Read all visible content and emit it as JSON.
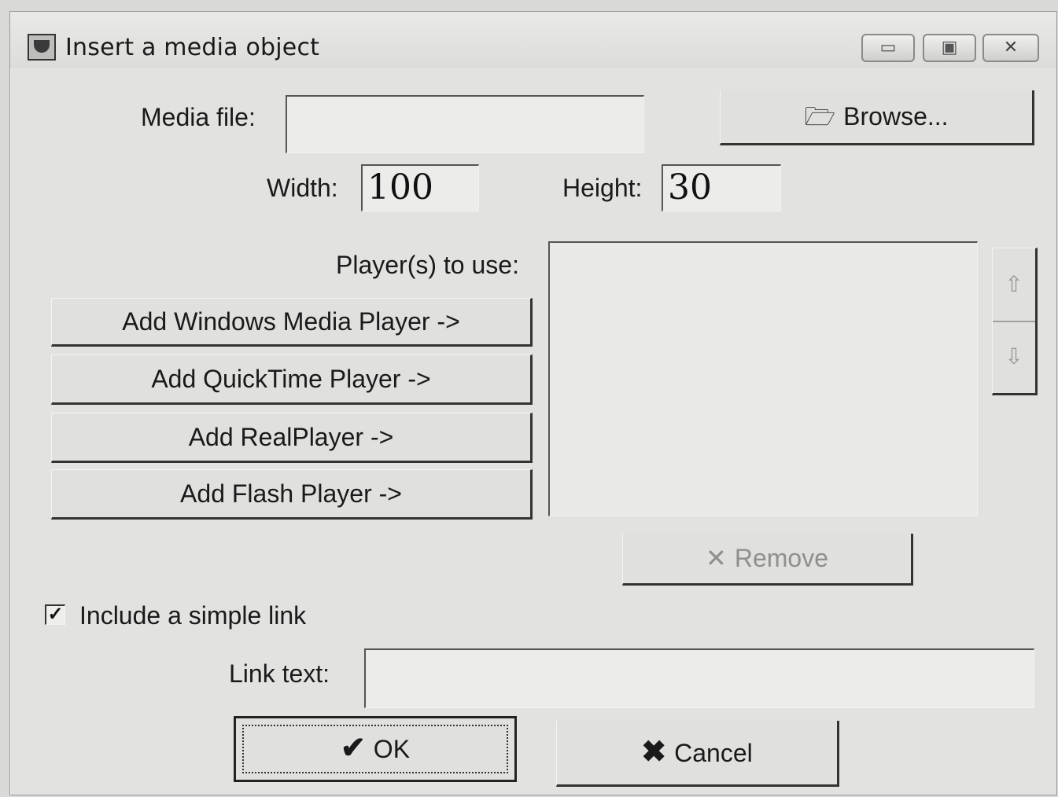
{
  "window": {
    "title": "Insert a media object",
    "controls": {
      "minimize": "▭",
      "maximize": "▣",
      "close": "✕"
    }
  },
  "media_file": {
    "label": "Media file:",
    "value": "",
    "browse_icon": "folder-open-icon",
    "browse_glyph": "🗁",
    "browse_label": "Browse..."
  },
  "size": {
    "width_label": "Width:",
    "width_value": "100",
    "height_label": "Height:",
    "height_value": "30"
  },
  "players": {
    "label": "Player(s) to use:",
    "buttons": [
      "Add Windows Media Player ->",
      "Add QuickTime Player ->",
      "Add RealPlayer ->",
      "Add Flash Player ->"
    ],
    "list": [],
    "move_up_glyph": "⇧",
    "move_down_glyph": "⇩",
    "remove_glyph": "✕",
    "remove_label": "Remove"
  },
  "link": {
    "checkbox_checked": true,
    "checkbox_mark": "✓",
    "checkbox_label": "Include a simple link",
    "text_label": "Link text:",
    "text_value": ""
  },
  "actions": {
    "ok_glyph": "✔",
    "ok_label": "OK",
    "cancel_glyph": "✖",
    "cancel_label": "Cancel"
  },
  "colors": {
    "window_bg": "#e2e2e0",
    "disabled_text": "#8f8f8d"
  }
}
